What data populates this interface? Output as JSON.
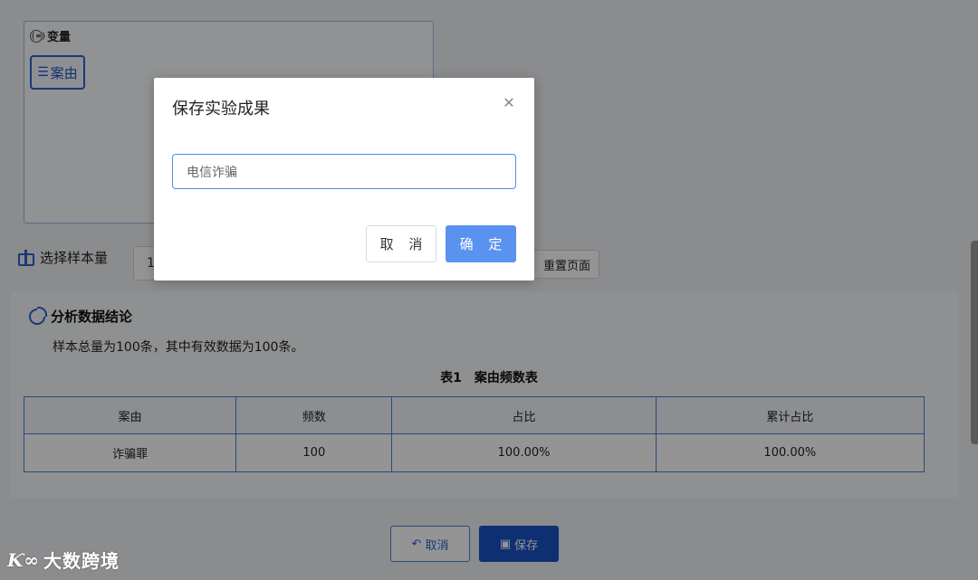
{
  "variables": {
    "title": "变量",
    "title_icon": "variable-brace-icon",
    "tag_icon": "list-lines-icon",
    "tag_label": "案由"
  },
  "sample": {
    "label": "选择样本量",
    "icon": "scale-icon",
    "value_visible": "1",
    "reset_label": "重置页面"
  },
  "conclusion": {
    "title": "分析数据结论",
    "icon": "pie-chart-icon",
    "summary": "样本总量为100条，其中有效数据为100条。",
    "table_title": "表1　案由频数表",
    "headers": [
      "案由",
      "频数",
      "占比",
      "累计占比"
    ],
    "rows": [
      [
        "诈骗罪",
        "100",
        "100.00%",
        "100.00%"
      ]
    ]
  },
  "footer": {
    "cancel_label": "取消",
    "cancel_icon": "undo-icon",
    "save_label": "保存",
    "save_icon": "save-icon"
  },
  "watermark": {
    "logo": "Ƙ∞",
    "text": "大数跨境"
  },
  "modal": {
    "title": "保存实验成果",
    "close_icon": "close-icon",
    "input_value": "电信诈骗",
    "cancel_label": "取 消",
    "ok_label": "确 定"
  },
  "colors": {
    "accent": "#2a63d3",
    "primary_button": "#5a92f0",
    "save_button": "#1a52c7"
  }
}
